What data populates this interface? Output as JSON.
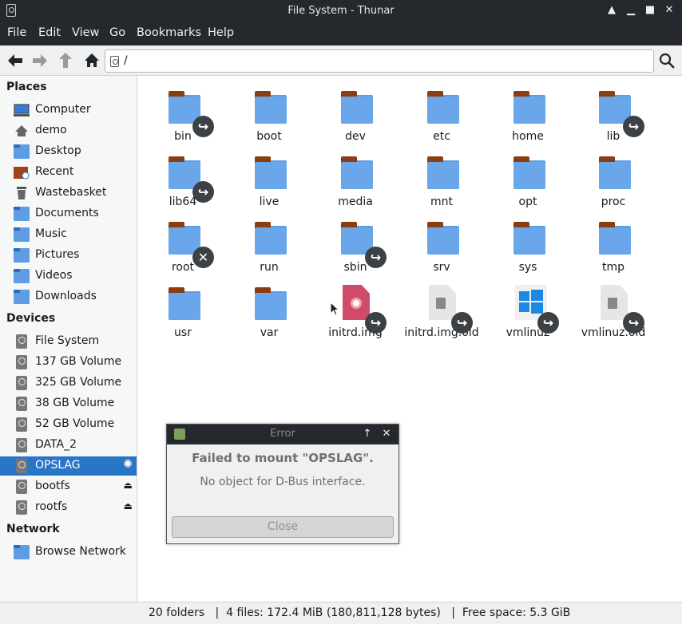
{
  "window": {
    "title": "File System - Thunar",
    "controls": [
      "up-arrow-icon",
      "minimize-icon",
      "maximize-icon",
      "close-icon"
    ]
  },
  "menu": [
    "File",
    "Edit",
    "View",
    "Go",
    "Bookmarks",
    "Help"
  ],
  "toolbar": {
    "path": "/",
    "buttons": [
      "back-arrow-icon",
      "forward-arrow-icon",
      "up-arrow-icon",
      "home-icon",
      "search-icon"
    ]
  },
  "sidebar": {
    "places_title": "Places",
    "places": [
      {
        "label": "Computer",
        "icon": "computer-icon"
      },
      {
        "label": "demo",
        "icon": "home-icon"
      },
      {
        "label": "Desktop",
        "icon": "desktop-icon"
      },
      {
        "label": "Recent",
        "icon": "recent-folder-icon"
      },
      {
        "label": "Wastebasket",
        "icon": "trash-icon"
      },
      {
        "label": "Documents",
        "icon": "documents-folder-icon"
      },
      {
        "label": "Music",
        "icon": "music-folder-icon"
      },
      {
        "label": "Pictures",
        "icon": "pictures-folder-icon"
      },
      {
        "label": "Videos",
        "icon": "videos-folder-icon"
      },
      {
        "label": "Downloads",
        "icon": "downloads-folder-icon"
      }
    ],
    "devices_title": "Devices",
    "devices": [
      {
        "label": "File System",
        "icon": "drive-icon"
      },
      {
        "label": "137 GB Volume",
        "icon": "drive-icon"
      },
      {
        "label": "325 GB Volume",
        "icon": "drive-icon"
      },
      {
        "label": "38 GB Volume",
        "icon": "drive-icon"
      },
      {
        "label": "52 GB Volume",
        "icon": "drive-icon"
      },
      {
        "label": "DATA_2",
        "icon": "drive-icon"
      },
      {
        "label": "OPSLAG",
        "icon": "drive-icon"
      },
      {
        "label": "bootfs",
        "icon": "drive-icon"
      },
      {
        "label": "rootfs",
        "icon": "drive-icon"
      }
    ],
    "network_title": "Network",
    "network": [
      {
        "label": "Browse Network",
        "icon": "network-folder-icon"
      }
    ]
  },
  "files": [
    {
      "name": "bin",
      "type": "folder",
      "badge": "symlink"
    },
    {
      "name": "boot",
      "type": "folder"
    },
    {
      "name": "dev",
      "type": "folder"
    },
    {
      "name": "etc",
      "type": "folder"
    },
    {
      "name": "home",
      "type": "folder"
    },
    {
      "name": "lib",
      "type": "folder",
      "badge": "symlink"
    },
    {
      "name": "lib64",
      "type": "folder",
      "badge": "symlink"
    },
    {
      "name": "live",
      "type": "folder"
    },
    {
      "name": "media",
      "type": "folder"
    },
    {
      "name": "mnt",
      "type": "folder"
    },
    {
      "name": "opt",
      "type": "folder"
    },
    {
      "name": "proc",
      "type": "folder"
    },
    {
      "name": "root",
      "type": "folder",
      "badge": "no-access"
    },
    {
      "name": "run",
      "type": "folder"
    },
    {
      "name": "sbin",
      "type": "folder",
      "badge": "symlink"
    },
    {
      "name": "srv",
      "type": "folder"
    },
    {
      "name": "sys",
      "type": "folder"
    },
    {
      "name": "tmp",
      "type": "folder"
    },
    {
      "name": "usr",
      "type": "folder"
    },
    {
      "name": "var",
      "type": "folder"
    },
    {
      "name": "initrd.img",
      "type": "disc-image",
      "badge": "symlink"
    },
    {
      "name": "initrd.img.old",
      "type": "file",
      "badge": "symlink"
    },
    {
      "name": "vmlinuz",
      "type": "windows-file",
      "badge": "symlink"
    },
    {
      "name": "vmlinuz.old",
      "type": "file",
      "badge": "symlink"
    }
  ],
  "statusbar": {
    "text": "20 folders   |  4 files: 172.4 MiB (180,811,128 bytes)   |  Free space: 5.3 GiB"
  },
  "dialog": {
    "title": "Error",
    "heading": "Failed to mount \"OPSLAG\".",
    "message": "No object for D-Bus interface.",
    "close_label": "Close"
  },
  "colors": {
    "titlebar": "#25282d",
    "selection": "#2a76c6",
    "folder": "#6aa7ea",
    "folder_tab": "#8a3d10"
  }
}
